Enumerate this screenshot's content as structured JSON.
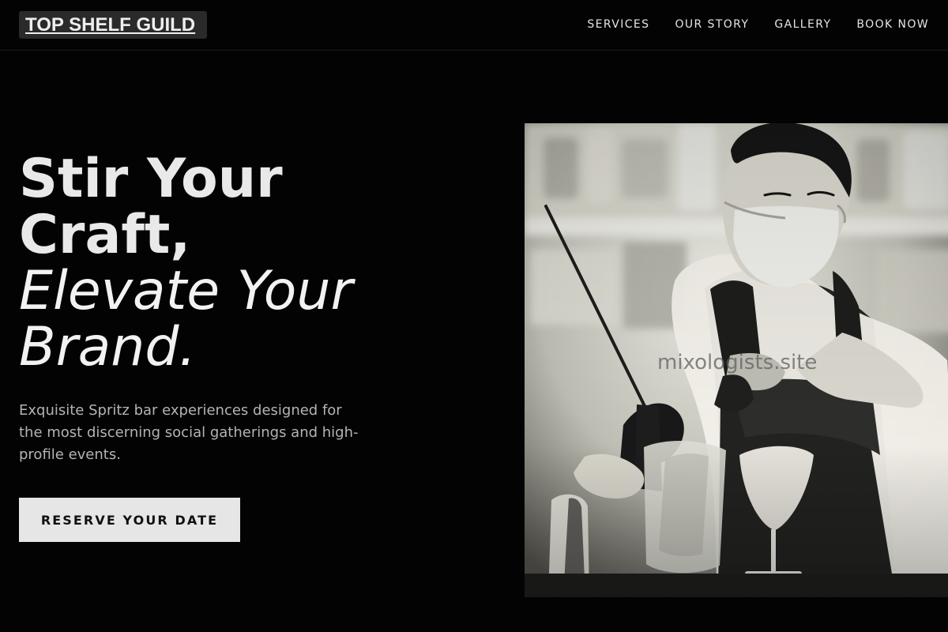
{
  "header": {
    "brand": "TOP SHELF GUILD",
    "nav": [
      {
        "label": "SERVICES"
      },
      {
        "label": "OUR STORY"
      },
      {
        "label": "GALLERY"
      },
      {
        "label": "BOOK NOW"
      }
    ]
  },
  "hero": {
    "title_line_1": "Stir Your",
    "title_line_2": "Craft,",
    "title_line_3": "Elevate Your",
    "title_line_4": "Brand.",
    "description": "Exquisite Spritz bar experiences designed for the most discerning social gatherings and high-profile events.",
    "cta_label": "RESERVE YOUR DATE"
  },
  "image": {
    "watermark": "mixologists.site",
    "subject": "bartender-with-cocktail-shaker"
  },
  "colors": {
    "background": "#030303",
    "text": "#e6e6e6",
    "muted_text": "#b4b4b4",
    "button_background": "#e6e6e6",
    "brand_background": "#2a2a2a"
  }
}
